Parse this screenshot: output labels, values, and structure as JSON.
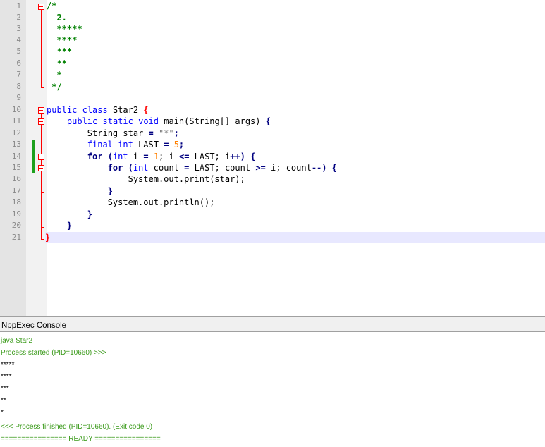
{
  "editor": {
    "line_numbers": [
      "1",
      "2",
      "3",
      "4",
      "5",
      "6",
      "7",
      "8",
      "9",
      "10",
      "11",
      "12",
      "13",
      "14",
      "15",
      "16",
      "17",
      "18",
      "19",
      "20",
      "21"
    ],
    "comment_open": "/*",
    "comment_lines": [
      "2.",
      "*****",
      "****",
      "***",
      "**",
      "*"
    ],
    "comment_close": "*/",
    "code": {
      "kw_public": "public",
      "kw_class": "class",
      "class_name": "Star2",
      "kw_static": "static",
      "kw_void": "void",
      "main_sig": "main(String[] args)",
      "string_type": "String star",
      "star_literal": "\"*\"",
      "kw_final": "final",
      "kw_int": "int",
      "last_decl": "LAST",
      "last_value": "5",
      "kw_for": "for",
      "loop1_init": "i",
      "loop1_start": "1",
      "loop1_cond": "; i",
      "loop1_limit": "LAST; i",
      "loop2_var": "count",
      "loop2_limit": "LAST; count",
      "loop2_tail": "i; count",
      "print_call": "System.out.print(star);",
      "println_call": "System.out.println();"
    }
  },
  "console": {
    "title": "NppExec Console",
    "lines": [
      {
        "text": "java Star2",
        "color": "green"
      },
      {
        "text": "Process started (PID=10660) >>>",
        "color": "green"
      },
      {
        "text": "*****",
        "color": "black"
      },
      {
        "text": "****",
        "color": "black"
      },
      {
        "text": "***",
        "color": "black"
      },
      {
        "text": "**",
        "color": "black"
      },
      {
        "text": "*",
        "color": "black"
      },
      {
        "text": "<<< Process finished (PID=10660). (Exit code 0)",
        "color": "green"
      },
      {
        "text": "================ READY ================",
        "color": "green"
      }
    ]
  },
  "colors": {
    "comment": "#008000",
    "keyword": "#0000ff",
    "number": "#ff8000",
    "fold_marker": "#ff0000",
    "change_marker": "#1da01d",
    "console_green": "#3a9a1a"
  }
}
